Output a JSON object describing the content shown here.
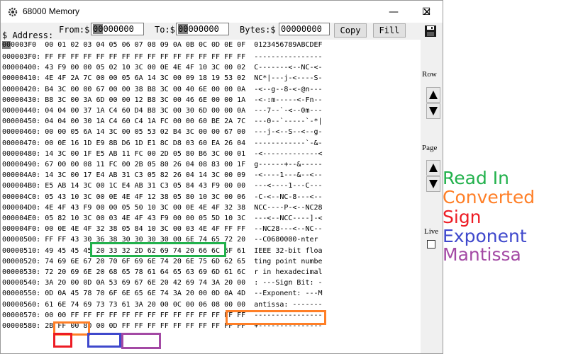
{
  "window": {
    "title": "68000 Memory",
    "controls": {
      "minimize": "—",
      "maximize": "☐",
      "close": "✕"
    }
  },
  "toolbar": {
    "address_label": "$ Address:",
    "from_label": "From:$",
    "from_value_hl": "00",
    "from_value_rest": "000000",
    "to_label": "To:$",
    "to_value_hl": "00",
    "to_value_rest": "000000",
    "bytes_label": "Bytes:$",
    "bytes_value": "00000000",
    "copy_label": "Copy",
    "fill_label": "Fill",
    "address_hl": "00",
    "address_rest": "0003F0"
  },
  "header_columns": "00 01 02 03 04 05 06 07 08 09 0A 0B 0C 0D 0E 0F  0123456789ABCDEF",
  "rows": [
    "000003F0: FF FF FF FF FF FF FF FF FF FF FF FF FF FF FF FF  ----------------",
    "00000400: 43 F9 00 00 05 02 10 3C 00 0E 4E 4F 10 3C 00 02  C-------<--NC-<-",
    "00000410: 4E 4F 2A 7C 00 00 05 6A 14 3C 00 09 18 19 53 02  NC*|---j-<----S-",
    "00000420: B4 3C 00 00 67 00 00 38 B8 3C 00 40 6E 00 00 0A  -<--g--8-<-@n---",
    "00000430: B8 3C 00 3A 6D 00 00 12 B8 3C 00 46 6E 00 00 1A  -<-:m-----<-Fn--",
    "00000440: 04 04 00 37 1A C4 60 D4 B8 3C 00 30 6D 00 00 0A  ---7--`-<--0m---",
    "00000450: 04 04 00 30 1A C4 60 C4 1A FC 00 00 60 BE 2A 7C  ---0--`-----`-*|",
    "00000460: 00 00 05 6A 14 3C 00 05 53 02 B4 3C 00 00 67 00  ---j-<--S--<--g-",
    "00000470: 00 0E 16 1D E9 8B D6 1D E1 8C D8 03 60 EA 26 04  ------------`-&-",
    "00000480: 14 3C 00 1F E5 AB 11 FC 00 2D 05 80 B6 3C 00 01  -<-------------<",
    "00000490: 67 00 00 08 11 FC 00 2B 05 80 26 04 08 83 00 1F  g------+--&-----",
    "000004A0: 14 3C 00 17 E4 AB 31 C3 05 82 26 04 14 3C 00 09  -<----1---&--<--",
    "000004B0: E5 AB 14 3C 00 1C E4 AB 31 C3 05 84 43 F9 00 00  ---<----1---C---",
    "000004C0: 05 43 10 3C 00 0E 4E 4F 12 38 05 80 10 3C 00 06  -C-<--NC-8---<--",
    "000004D0: 4E 4F 43 F9 00 00 05 50 10 3C 00 0E 4E 4F 32 38  NCC----P-<--NC28",
    "000004E0: 05 82 10 3C 00 03 4E 4F 43 F9 00 00 05 5D 10 3C  ---<--NCC----]-<",
    "000004F0: 00 0E 4E 4F 32 38 05 84 10 3C 00 03 4E 4F FF FF  --NC28---<--NC--",
    "00000500: FF FF 43 30 36 38 30 30 30 30 00 6E 74 65 72 20  --C0680000-nter ",
    "00000510: 49 45 45 45 20 33 32 2D 62 69 74 20 66 6C 6F 61  IEEE 32-bit floa",
    "00000520: 74 69 6E 67 20 70 6F 69 6E 74 20 6E 75 6D 62 65  ting point numbe",
    "00000530: 72 20 69 6E 20 68 65 78 61 64 65 63 69 6D 61 6C  r in hexadecimal",
    "00000540: 3A 20 00 0D 0A 53 69 67 6E 20 42 69 74 3A 20 00  : ---Sign Bit: -",
    "00000550: 0D 0A 45 78 70 6F 6E 65 6E 74 3A 20 00 0D 0A 4D  --Exponent: ---M",
    "00000560: 61 6E 74 69 73 73 61 3A 20 00 0C 00 06 08 00 00  antissa: -------",
    "00000570: 00 00 FF FF FF FF FF FF FF FF FF FF FF FF FF FF  ----------------",
    "00000580: 2B FF 00 80 00 0D FF FF FF FF FF FF FF FF FF FF  +---------------"
  ],
  "side": {
    "row_label": "Row",
    "page_label": "Page",
    "live_label": "Live"
  },
  "legend": [
    {
      "label": "Read In",
      "color": "#22b14c"
    },
    {
      "label": "Converted",
      "color": "#ff7f27"
    },
    {
      "label": "Sign",
      "color": "#ed1c24"
    },
    {
      "label": "Exponent",
      "color": "#3f48cc"
    },
    {
      "label": "Mantissa",
      "color": "#a349a4"
    }
  ],
  "icons": {
    "app": "gear-icon",
    "save": "floppy-disk-icon",
    "up": "triangle-up-icon",
    "down": "triangle-down-icon"
  }
}
